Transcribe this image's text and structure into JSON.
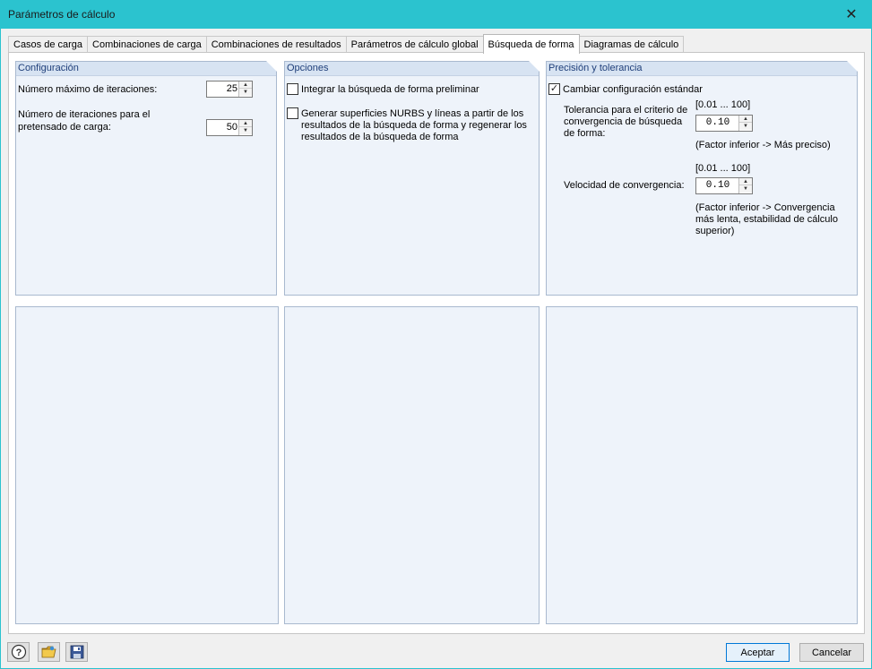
{
  "window": {
    "title": "Parámetros de cálculo",
    "close_glyph": "✕"
  },
  "tabs": [
    {
      "label": "Casos de carga",
      "active": false
    },
    {
      "label": "Combinaciones de carga",
      "active": false
    },
    {
      "label": "Combinaciones de resultados",
      "active": false
    },
    {
      "label": "Parámetros de cálculo global",
      "active": false
    },
    {
      "label": "Búsqueda de forma",
      "active": true
    },
    {
      "label": "Diagramas de cálculo",
      "active": false
    }
  ],
  "configuracion": {
    "header": "Configuración",
    "max_iter_label": "Número máximo de iteraciones:",
    "max_iter_value": "25",
    "pretensado_label_1": "Número de iteraciones para el",
    "pretensado_label_2": "pretensado de carga:",
    "pretensado_value": "50"
  },
  "opciones": {
    "header": "Opciones",
    "opt1_label": "Integrar la búsqueda de forma preliminar",
    "opt1_checked": false,
    "opt2_line1": "Generar superficies NURBS y líneas a partir de los",
    "opt2_line2": "resultados de la búsqueda de forma y regenerar los",
    "opt2_line3": "resultados de la búsqueda de forma",
    "opt2_checked": false
  },
  "precision": {
    "header": "Precisión y tolerancia",
    "change_label": "Cambiar configuración estándar",
    "change_checked": true,
    "check_glyph": "✓",
    "tol_label_1": "Tolerancia para el criterio de",
    "tol_label_2": "convergencia de búsqueda",
    "tol_label_3": "de forma:",
    "tol_range": "[0.01 ... 100]",
    "tol_value": "0.10",
    "tol_note": "(Factor inferior -> Más preciso)",
    "vel_label": "Velocidad de convergencia:",
    "vel_range": "[0.01 ... 100]",
    "vel_value": "0.10",
    "vel_note_1": "(Factor inferior -> Convergencia",
    "vel_note_2": "más lenta, estabilidad de cálculo",
    "vel_note_3": "superior)"
  },
  "footer": {
    "ok_label": "Aceptar",
    "cancel_label": "Cancelar"
  },
  "icons": {
    "help": "help-icon",
    "open": "open-folder-icon",
    "save": "save-icon",
    "up_glyph": "▲",
    "down_glyph": "▼"
  },
  "colors": {
    "titlebar": "#2bc3cf",
    "panel_bg": "#eef3fa",
    "panel_head": "#d7e3f2",
    "panel_head_text": "#1f3f7a",
    "primary_border": "#0078d7"
  }
}
